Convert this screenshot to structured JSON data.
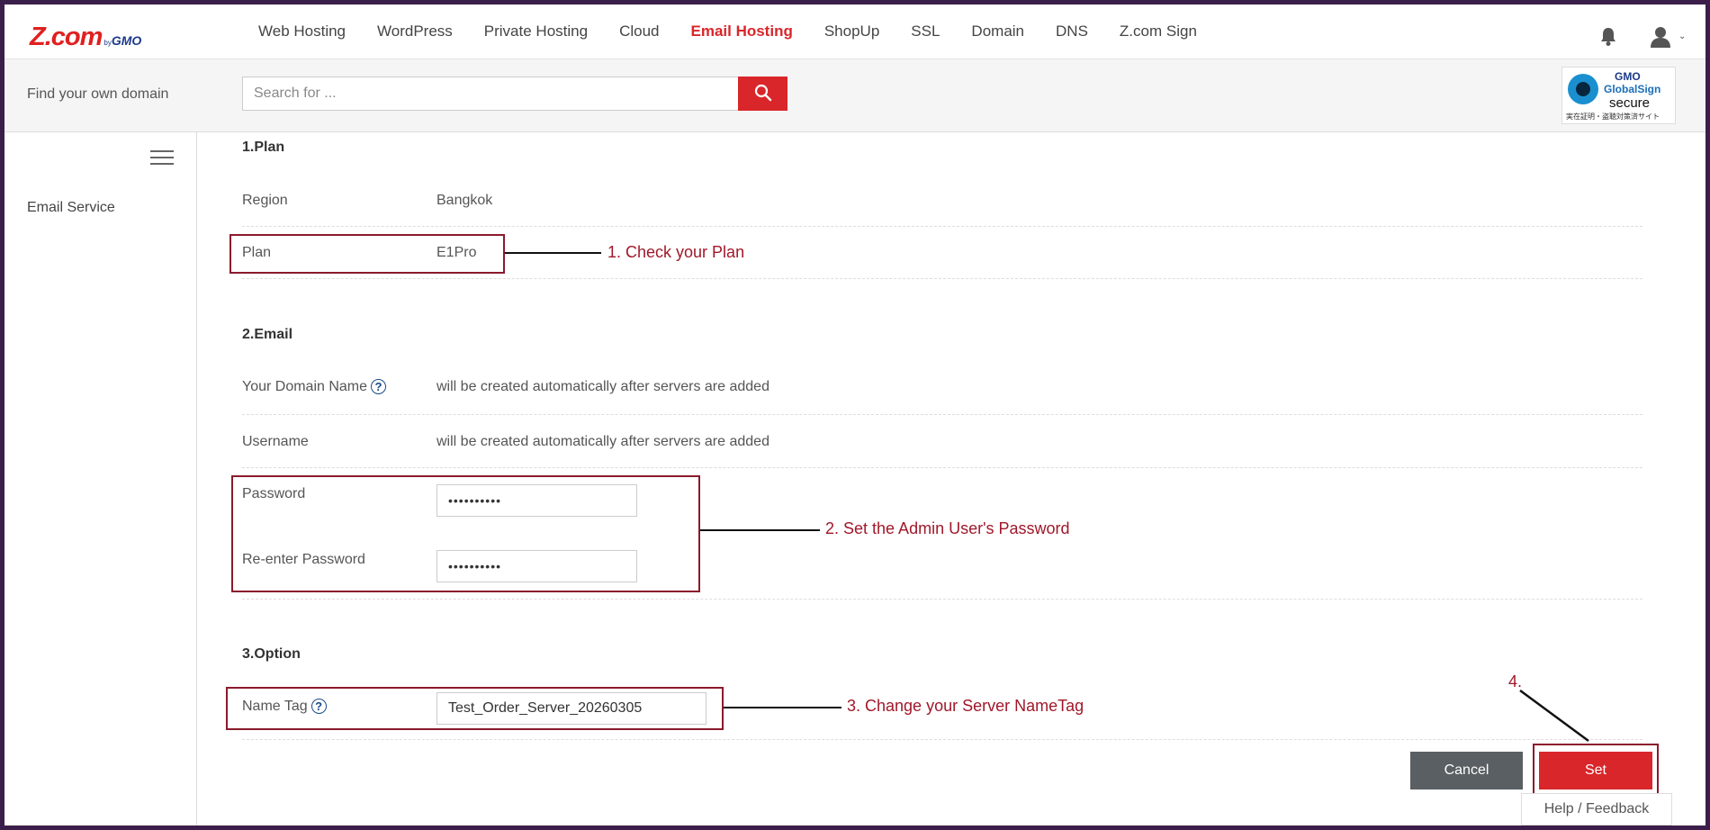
{
  "header": {
    "logo_main": "Z.com",
    "logo_by": "by",
    "logo_gmo": "GMO",
    "nav": [
      {
        "label": "Web Hosting",
        "active": false
      },
      {
        "label": "WordPress",
        "active": false
      },
      {
        "label": "Private Hosting",
        "active": false
      },
      {
        "label": "Cloud",
        "active": false
      },
      {
        "label": "Email Hosting",
        "active": true
      },
      {
        "label": "ShopUp",
        "active": false
      },
      {
        "label": "SSL",
        "active": false
      },
      {
        "label": "Domain",
        "active": false
      },
      {
        "label": "DNS",
        "active": false
      },
      {
        "label": "Z.com Sign",
        "active": false
      }
    ],
    "icons": {
      "notifications": "bell-icon",
      "account": "user-icon",
      "account_menu": "chevron-down-icon"
    }
  },
  "domain_search": {
    "label": "Find your own domain",
    "placeholder": "Search for ...",
    "button_icon": "search-icon"
  },
  "trust_badge": {
    "gmo": "GMO",
    "globalsign": "GlobalSign",
    "secure": "secure",
    "subtext": "実在証明・盗聴対策済サイト"
  },
  "sidebar": {
    "menu_icon": "hamburger-menu-icon",
    "items": [
      {
        "label": "Email Service"
      }
    ]
  },
  "form": {
    "plan_section": {
      "title": "1.Plan",
      "region_label": "Region",
      "region_value": "Bangkok",
      "plan_label": "Plan",
      "plan_value": "E1Pro"
    },
    "email_section": {
      "title": "2.Email",
      "domain_label": "Your Domain Name",
      "domain_value": "will be created automatically after servers are added",
      "username_label": "Username",
      "username_value": "will be created automatically after servers are added",
      "password_label": "Password",
      "password_value": "••••••••••",
      "reenter_label": "Re-enter Password",
      "reenter_value": "••••••••••"
    },
    "option_section": {
      "title": "3.Option",
      "nametag_label": "Name Tag",
      "nametag_value": "Test_Order_Server_20260305"
    },
    "help_icon": "question-circle-icon"
  },
  "actions": {
    "cancel": "Cancel",
    "set": "Set",
    "help_feedback": "Help / Feedback"
  },
  "annotations": {
    "step1": "1. Check your Plan",
    "step2": "2. Set the Admin User's Password",
    "step3": "3. Change your Server NameTag",
    "step4": "4.",
    "color": "#8b1a2c"
  },
  "colors": {
    "brand_red": "#d9262a",
    "cancel_gray": "#5a5f63",
    "annotation": "#a0182a"
  }
}
